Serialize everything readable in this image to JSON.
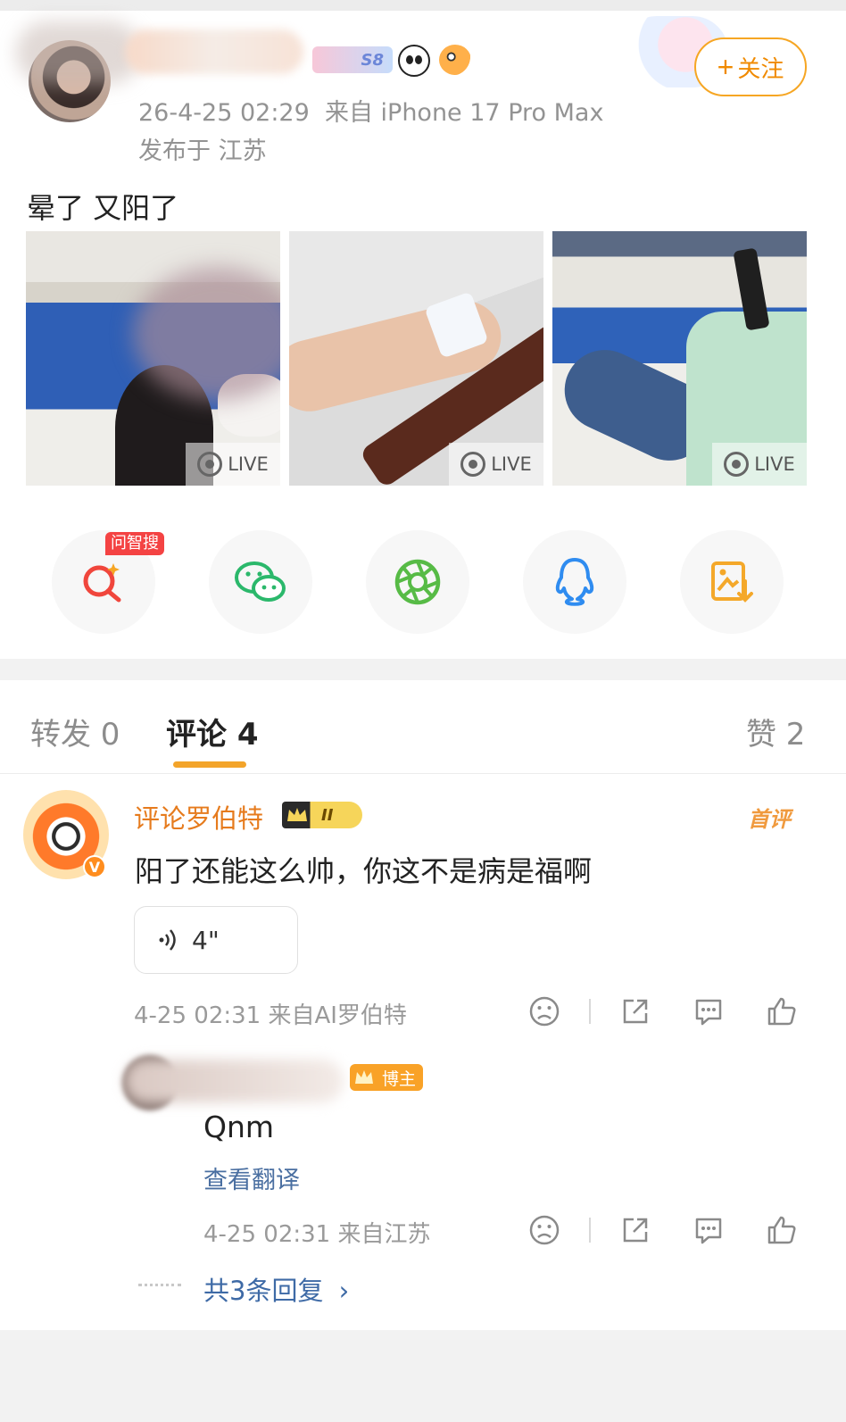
{
  "post": {
    "time": "26-4-25 02:29",
    "source": "来自 iPhone 17 Pro Max",
    "location": "发布于 江苏",
    "text": "晕了 又阳了",
    "follow_label": "关注",
    "vip_level": "S8",
    "live_label": "LIVE",
    "photo_count": 3
  },
  "share": {
    "ai_search_badge": "问智搜",
    "icons": [
      "ai-search-icon",
      "wechat-icon",
      "moments-icon",
      "qq-icon",
      "save-image-icon"
    ],
    "colors": [
      "#f0463c",
      "#2bb86b",
      "#57bb46",
      "#2f8cf0",
      "#f4a82a"
    ]
  },
  "tabs": {
    "repost": "转发 0",
    "comment": "评论 4",
    "like": "赞 2",
    "accent_color": "#f3a42a"
  },
  "comment": {
    "author": "评论罗伯特",
    "rank_badge": "II",
    "first_label": "首评",
    "text": "阳了还能这么帅，你这不是病是福啊",
    "voice_duration": "4\"",
    "time": "4-25 02:31",
    "source": "来自AI罗伯特",
    "verified_mark": "V"
  },
  "reply": {
    "badge": "博主",
    "text": "Qnm",
    "translate": "查看翻译",
    "time": "4-25 02:31",
    "source": "来自江苏",
    "more": "共3条回复"
  }
}
